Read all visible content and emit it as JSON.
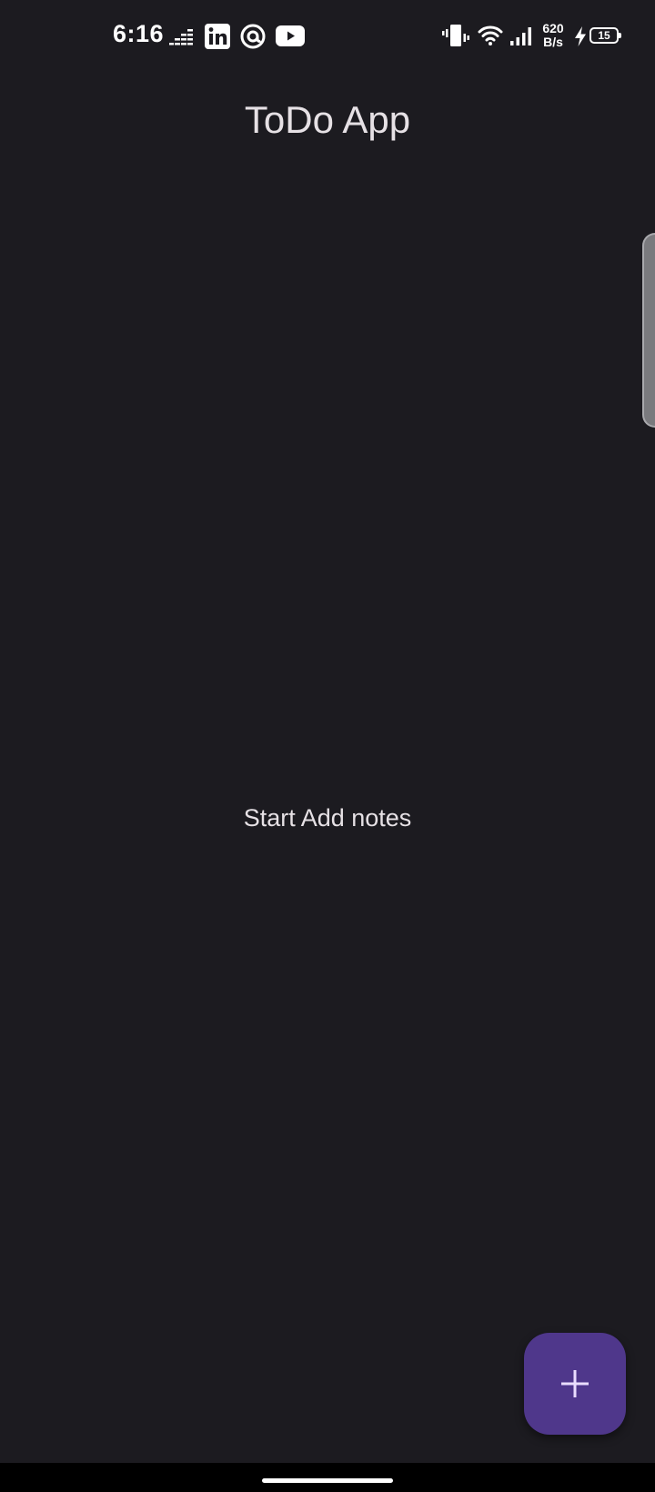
{
  "status_bar": {
    "time": "6:16",
    "net_speed_value": "620",
    "net_speed_unit": "B/s",
    "battery_level": "15",
    "notification_icons": [
      "deezer-icon",
      "linkedin-icon",
      "at-sign-icon",
      "youtube-icon"
    ],
    "system_icons": [
      "vibrate-icon",
      "wifi-icon",
      "signal-icon",
      "charging-icon",
      "battery-icon"
    ]
  },
  "app_bar": {
    "title": "ToDo App"
  },
  "main": {
    "empty_message": "Start Add notes"
  },
  "fab": {
    "icon": "plus-icon"
  },
  "colors": {
    "background": "#1c1b20",
    "fab": "#4f378b",
    "text": "#e6e1e5"
  }
}
